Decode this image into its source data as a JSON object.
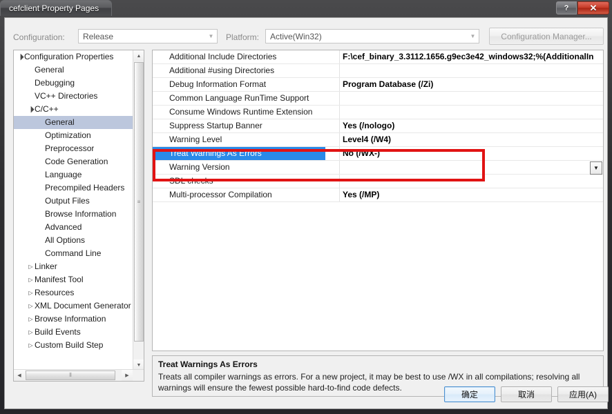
{
  "window": {
    "title": "cefclient Property Pages",
    "caption_buttons": [
      {
        "name": "help-button",
        "glyph": "?"
      },
      {
        "name": "close-button",
        "glyph": "✕"
      }
    ]
  },
  "topbar": {
    "configuration_label": "Configuration:",
    "configuration_value": "Release",
    "platform_label": "Platform:",
    "platform_value": "Active(Win32)",
    "configuration_manager_button": "Configuration Manager..."
  },
  "tree": {
    "nodes": [
      {
        "label": "Configuration Properties",
        "indent": 0,
        "twisty": "expanded",
        "selected": false
      },
      {
        "label": "General",
        "indent": 1,
        "twisty": "none",
        "selected": false
      },
      {
        "label": "Debugging",
        "indent": 1,
        "twisty": "none",
        "selected": false
      },
      {
        "label": "VC++ Directories",
        "indent": 1,
        "twisty": "none",
        "selected": false
      },
      {
        "label": "C/C++",
        "indent": 1,
        "twisty": "expanded",
        "selected": false
      },
      {
        "label": "General",
        "indent": 2,
        "twisty": "none",
        "selected": true
      },
      {
        "label": "Optimization",
        "indent": 2,
        "twisty": "none",
        "selected": false
      },
      {
        "label": "Preprocessor",
        "indent": 2,
        "twisty": "none",
        "selected": false
      },
      {
        "label": "Code Generation",
        "indent": 2,
        "twisty": "none",
        "selected": false
      },
      {
        "label": "Language",
        "indent": 2,
        "twisty": "none",
        "selected": false
      },
      {
        "label": "Precompiled Headers",
        "indent": 2,
        "twisty": "none",
        "selected": false
      },
      {
        "label": "Output Files",
        "indent": 2,
        "twisty": "none",
        "selected": false
      },
      {
        "label": "Browse Information",
        "indent": 2,
        "twisty": "none",
        "selected": false
      },
      {
        "label": "Advanced",
        "indent": 2,
        "twisty": "none",
        "selected": false
      },
      {
        "label": "All Options",
        "indent": 2,
        "twisty": "none",
        "selected": false
      },
      {
        "label": "Command Line",
        "indent": 2,
        "twisty": "none",
        "selected": false
      },
      {
        "label": "Linker",
        "indent": 1,
        "twisty": "collapsed",
        "selected": false
      },
      {
        "label": "Manifest Tool",
        "indent": 1,
        "twisty": "collapsed",
        "selected": false
      },
      {
        "label": "Resources",
        "indent": 1,
        "twisty": "collapsed",
        "selected": false
      },
      {
        "label": "XML Document Generator",
        "indent": 1,
        "twisty": "collapsed",
        "selected": false
      },
      {
        "label": "Browse Information",
        "indent": 1,
        "twisty": "collapsed",
        "selected": false
      },
      {
        "label": "Build Events",
        "indent": 1,
        "twisty": "collapsed",
        "selected": false
      },
      {
        "label": "Custom Build Step",
        "indent": 1,
        "twisty": "collapsed",
        "selected": false
      }
    ],
    "vscroll_up": "▲",
    "vscroll_down": "▼",
    "hscroll_left": "◀",
    "hscroll_right": "▶",
    "grip": "≡",
    "hgrip": "⦀"
  },
  "grid": {
    "rows": [
      {
        "name": "Additional Include Directories",
        "value": "F:\\cef_binary_3.3112.1656.g9ec3e42_windows32;%(AdditionalIn",
        "selected": false
      },
      {
        "name": "Additional #using Directories",
        "value": "",
        "selected": false
      },
      {
        "name": "Debug Information Format",
        "value": "Program Database (/Zi)",
        "selected": false
      },
      {
        "name": "Common Language RunTime Support",
        "value": "",
        "selected": false
      },
      {
        "name": "Consume Windows Runtime Extension",
        "value": "",
        "selected": false
      },
      {
        "name": "Suppress Startup Banner",
        "value": "Yes (/nologo)",
        "selected": false
      },
      {
        "name": "Warning Level",
        "value": "Level4 (/W4)",
        "selected": false
      },
      {
        "name": "Treat Warnings As Errors",
        "value": "No (/WX-)",
        "selected": true
      },
      {
        "name": "Warning Version",
        "value": "",
        "selected": false
      },
      {
        "name": "SDL checks",
        "value": "",
        "selected": false
      },
      {
        "name": "Multi-processor Compilation",
        "value": "Yes (/MP)",
        "selected": false
      }
    ],
    "dropdown_glyph": "▼",
    "highlight_color": "#e11313",
    "selection_color": "#2a8ae8"
  },
  "description": {
    "title": "Treat Warnings As Errors",
    "body": "Treats all compiler warnings as errors. For a new project, it may be best to use /WX in all compilations; resolving all warnings will ensure the fewest possible hard-to-find code defects."
  },
  "footer": {
    "ok": "确定",
    "cancel": "取消",
    "apply": "应用(A)"
  }
}
